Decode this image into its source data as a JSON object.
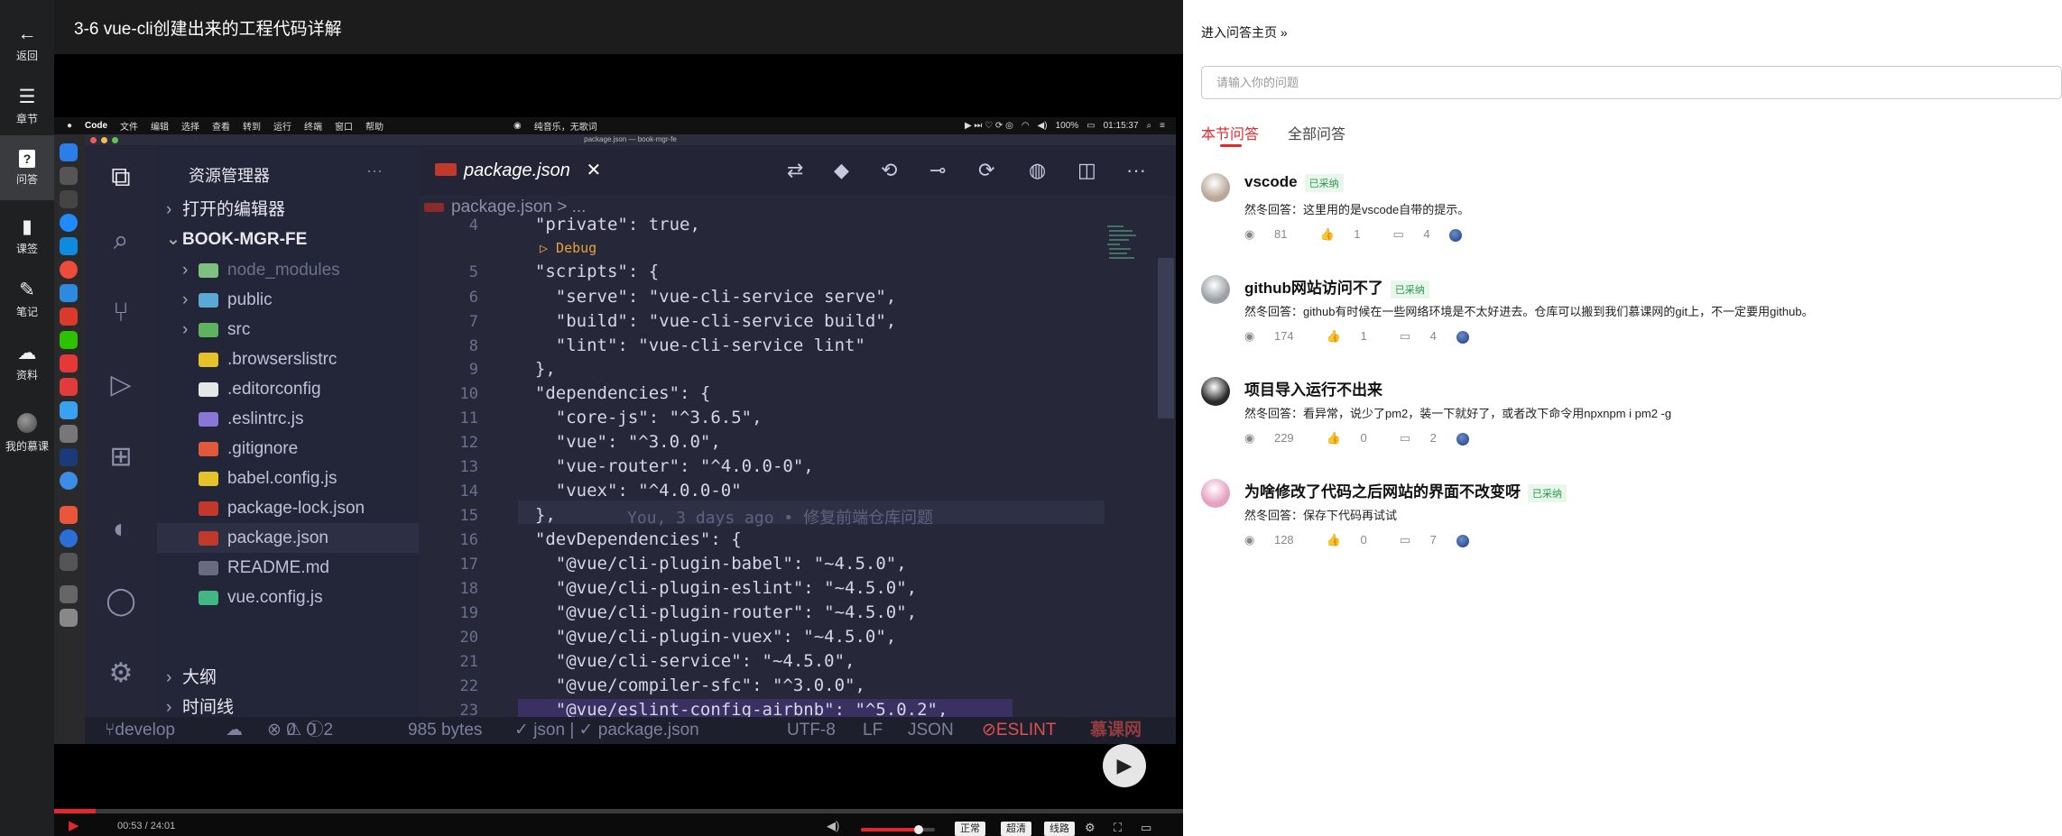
{
  "sidebar": {
    "items": [
      {
        "label": "返回",
        "icon": "arrow-left-icon"
      },
      {
        "label": "章节",
        "icon": "menu-icon"
      },
      {
        "label": "问答",
        "icon": "question-icon"
      },
      {
        "label": "课签",
        "icon": "bookmark-icon"
      },
      {
        "label": "笔记",
        "icon": "pencil-icon"
      },
      {
        "label": "资料",
        "icon": "cloud-download-icon"
      },
      {
        "label": "我的慕课",
        "icon": "avatar"
      }
    ]
  },
  "lesson": {
    "title": "3-6 vue-cli创建出来的工程代码详解"
  },
  "mac_menubar": {
    "app": "Code",
    "menus": [
      "文件",
      "编辑",
      "选择",
      "查看",
      "转到",
      "运行",
      "终端",
      "窗口",
      "帮助"
    ],
    "now_playing": "纯音乐，无歌词",
    "battery": "100%",
    "time": "01:15:37"
  },
  "vscode": {
    "window_title": "package.json — book-mgr-fe",
    "explorer_title": "资源管理器",
    "open_editors": "打开的编辑器",
    "project": "BOOK-MGR-FE",
    "files": [
      {
        "name": "node_modules",
        "kind": "folder",
        "color": "#7fbf7f"
      },
      {
        "name": "public",
        "kind": "folder",
        "color": "#5ba7d6"
      },
      {
        "name": "src",
        "kind": "folder",
        "color": "#5fb35f"
      },
      {
        "name": ".browserslistrc",
        "kind": "file",
        "color": "#e6c229"
      },
      {
        "name": ".editorconfig",
        "kind": "file",
        "color": "#e6e6e6"
      },
      {
        "name": ".eslintrc.js",
        "kind": "file",
        "color": "#8a76d6"
      },
      {
        "name": ".gitignore",
        "kind": "file",
        "color": "#e05a3a"
      },
      {
        "name": "babel.config.js",
        "kind": "file",
        "color": "#e6c229"
      },
      {
        "name": "package-lock.json",
        "kind": "file",
        "color": "#c0392b"
      },
      {
        "name": "package.json",
        "kind": "file",
        "color": "#c0392b"
      },
      {
        "name": "README.md",
        "kind": "file",
        "color": "#6b6b7f"
      },
      {
        "name": "vue.config.js",
        "kind": "file",
        "color": "#41b883"
      }
    ],
    "outline": "大纲",
    "timeline": "时间线",
    "tab": "package.json",
    "breadcrumb": "package.json > ...",
    "debug_label": "▷ Debug",
    "blame": "You, 3 days ago • 修复前端仓库问题",
    "code": [
      {
        "n": "4",
        "t": "  \"private\": true,"
      },
      {
        "n": "5",
        "t": "  \"scripts\": {"
      },
      {
        "n": "6",
        "t": "    \"serve\": \"vue-cli-service serve\","
      },
      {
        "n": "7",
        "t": "    \"build\": \"vue-cli-service build\","
      },
      {
        "n": "8",
        "t": "    \"lint\": \"vue-cli-service lint\""
      },
      {
        "n": "9",
        "t": "  },"
      },
      {
        "n": "10",
        "t": "  \"dependencies\": {"
      },
      {
        "n": "11",
        "t": "    \"core-js\": \"^3.6.5\","
      },
      {
        "n": "12",
        "t": "    \"vue\": \"^3.0.0\","
      },
      {
        "n": "13",
        "t": "    \"vue-router\": \"^4.0.0-0\","
      },
      {
        "n": "14",
        "t": "    \"vuex\": \"^4.0.0-0\""
      },
      {
        "n": "15",
        "t": "  },"
      },
      {
        "n": "16",
        "t": "  \"devDependencies\": {"
      },
      {
        "n": "17",
        "t": "    \"@vue/cli-plugin-babel\": \"~4.5.0\","
      },
      {
        "n": "18",
        "t": "    \"@vue/cli-plugin-eslint\": \"~4.5.0\","
      },
      {
        "n": "19",
        "t": "    \"@vue/cli-plugin-router\": \"~4.5.0\","
      },
      {
        "n": "20",
        "t": "    \"@vue/cli-plugin-vuex\": \"~4.5.0\","
      },
      {
        "n": "21",
        "t": "    \"@vue/cli-service\": \"~4.5.0\","
      },
      {
        "n": "22",
        "t": "    \"@vue/compiler-sfc\": \"^3.0.0\","
      },
      {
        "n": "23",
        "t": "    \"@vue/eslint-config-airbnb\": \"^5.0.2\","
      }
    ],
    "status": {
      "branch": "develop",
      "errors": "0",
      "warnings": "0",
      "infos": "2",
      "size": "985 bytes",
      "schema": "✓ json | ✓ package.json",
      "encoding": "UTF-8",
      "eol": "LF",
      "language": "JSON",
      "eslint": "ESLINT",
      "watermark": "慕课网"
    }
  },
  "player": {
    "time": "00:53 / 24:01",
    "volume": 0.78,
    "progress": 0.037,
    "buttons": [
      "正常",
      "超清",
      "线路"
    ]
  },
  "qa": {
    "home_link": "进入问答主页 »",
    "search_placeholder": "请输入你的问题",
    "tabs": [
      "本节问答",
      "全部问答"
    ],
    "questions": [
      {
        "title": "vscode",
        "badge": "已采纳",
        "answer": "然冬回答：这里用的是vscode自带的提示。",
        "views": "81",
        "likes": "1",
        "comments": "4"
      },
      {
        "title": "github网站访问不了",
        "badge": "已采纳",
        "answer": "然冬回答：github有时候在一些网络环境是不太好进去。仓库可以搬到我们慕课网的git上，不一定要用github。",
        "views": "174",
        "likes": "1",
        "comments": "4"
      },
      {
        "title": "项目导入运行不出来",
        "badge": "",
        "answer": "然冬回答：看异常，说少了pm2，装一下就好了，或者改下命令用npxnpm i pm2 -g",
        "views": "229",
        "likes": "0",
        "comments": "2"
      },
      {
        "title": "为啥修改了代码之后网站的界面不改变呀",
        "badge": "已采纳",
        "answer": "然冬回答：保存下代码再试试",
        "views": "128",
        "likes": "0",
        "comments": "7"
      }
    ]
  }
}
